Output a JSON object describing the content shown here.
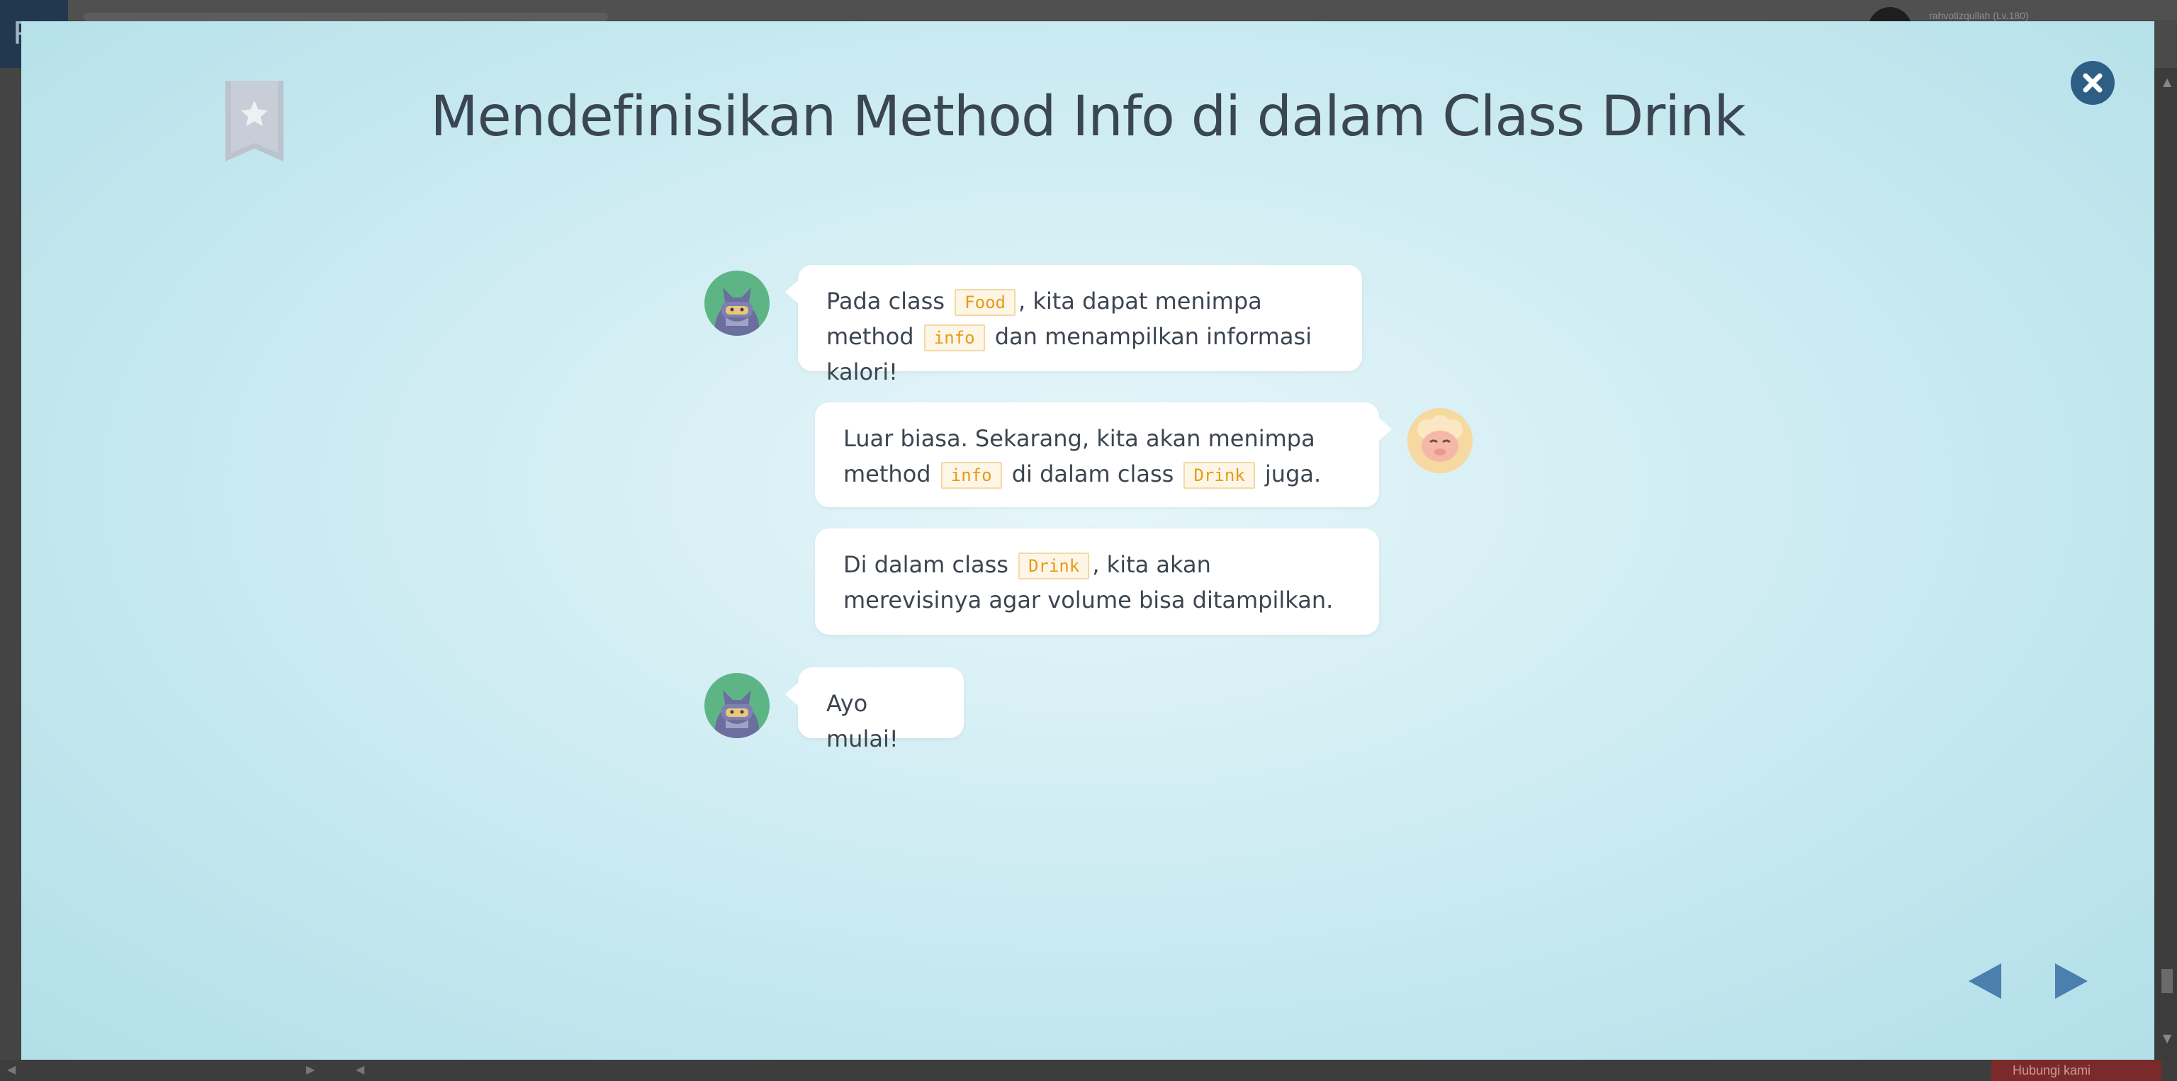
{
  "background_app": {
    "user_label": "rahvotizqullah (Lv.180)",
    "footer_button": "Hubungi kami"
  },
  "modal": {
    "title": "Mendefinisikan Method Info di dalam Class Drink",
    "messages": [
      {
        "speaker": "ninja",
        "parts": [
          "Pada class ",
          "Food",
          ", kita dapat menimpa method ",
          "info",
          " dan menampilkan informasi kalori!"
        ]
      },
      {
        "speaker": "sheep",
        "parts": [
          "Luar biasa. Sekarang, kita akan menimpa method ",
          "info",
          " di dalam class ",
          "Drink",
          " juga."
        ]
      },
      {
        "speaker": "sheep",
        "parts": [
          "Di dalam class ",
          "Drink",
          ", kita akan merevisinya agar volume bisa ditampilkan."
        ]
      },
      {
        "speaker": "ninja",
        "parts": [
          "Ayo mulai!"
        ]
      }
    ],
    "icons": {
      "bookmark": "bookmark-star-icon",
      "close": "close-icon",
      "prev": "triangle-left-icon",
      "next": "triangle-right-icon"
    },
    "colors": {
      "accent": "#2d5f86",
      "code_text": "#e59b13",
      "title_text": "#3b4653"
    }
  }
}
